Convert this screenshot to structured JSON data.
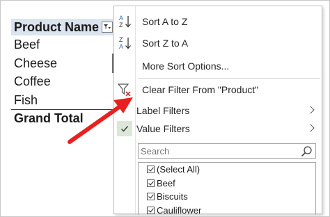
{
  "pivot": {
    "header": "Product Name",
    "rows": [
      "Beef",
      "Cheese",
      "Coffee",
      "Fish"
    ],
    "total": "Grand Total"
  },
  "menu": {
    "sort_az": "Sort A to Z",
    "sort_za": "Sort Z to A",
    "more_sort": "More Sort Options...",
    "clear_filter": "Clear Filter From \"Product\"",
    "label_filters": "Label Filters",
    "value_filters": "Value Filters",
    "search_placeholder": "Search",
    "checklist": [
      "(Select All)",
      "Beef",
      "Biscuits",
      "Cauliflower"
    ]
  },
  "colors": {
    "header_fill": "#dbe3ef",
    "sort_icon_blue": "#2e6db4",
    "clear_x_red": "#d9262a",
    "arrow_red": "#e8201f",
    "checked_fill": "#dbe7d7"
  },
  "icons": {
    "sort_az": "sort-ascending-icon",
    "sort_za": "sort-descending-icon",
    "clear_filter": "clear-filter-icon",
    "value_filters": "checkmark-icon",
    "search": "search-icon",
    "header_filter": "filter-dropdown-icon"
  }
}
